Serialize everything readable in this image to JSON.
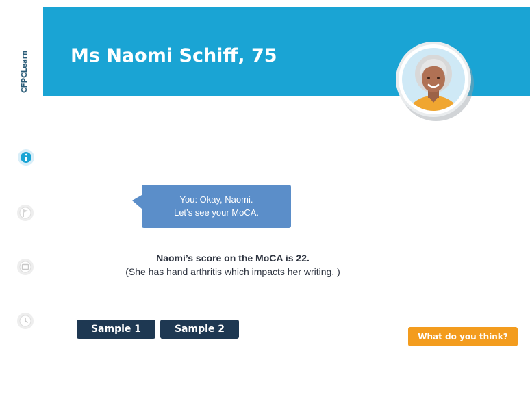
{
  "brand": {
    "text": "CFPCLearn"
  },
  "header": {
    "title": "Ms Naomi Schiff, 75"
  },
  "sidebar": {
    "icons": [
      {
        "name": "info-icon",
        "state": "active"
      },
      {
        "name": "flag-icon",
        "state": "inactive"
      },
      {
        "name": "note-icon",
        "state": "inactive"
      },
      {
        "name": "clock-icon",
        "state": "inactive"
      }
    ]
  },
  "dialogue": {
    "line1": "You: Okay, Naomi.",
    "line2": "Let’s see your MoCA."
  },
  "content": {
    "score": "Naomi’s score on the MoCA is 22.",
    "note": "(She has hand arthritis which impacts her writing. )"
  },
  "buttons": {
    "sample1": "Sample 1",
    "sample2": "Sample 2",
    "what_do_you_think": "What do you think?"
  },
  "colors": {
    "header": "#1aa4d4",
    "bubble": "#5b8ec9",
    "sample_button": "#1e3852",
    "action_button": "#f39c1e",
    "active_icon": "#1aa4d4"
  }
}
